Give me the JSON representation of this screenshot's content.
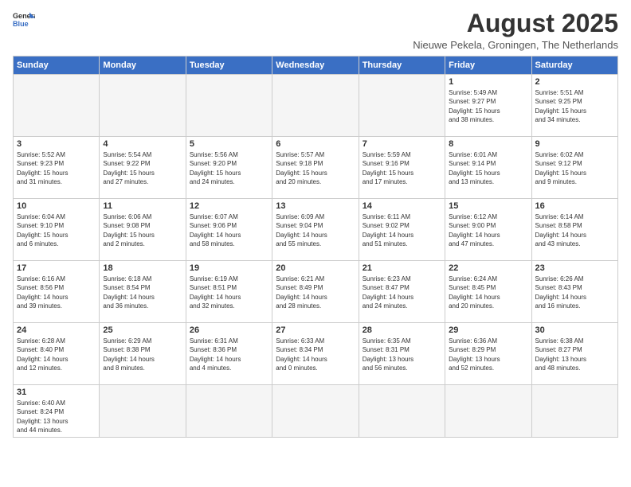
{
  "logo": {
    "line1": "General",
    "line2": "Blue"
  },
  "title": "August 2025",
  "subtitle": "Nieuwe Pekela, Groningen, The Netherlands",
  "weekdays": [
    "Sunday",
    "Monday",
    "Tuesday",
    "Wednesday",
    "Thursday",
    "Friday",
    "Saturday"
  ],
  "weeks": [
    [
      {
        "day": "",
        "info": ""
      },
      {
        "day": "",
        "info": ""
      },
      {
        "day": "",
        "info": ""
      },
      {
        "day": "",
        "info": ""
      },
      {
        "day": "",
        "info": ""
      },
      {
        "day": "1",
        "info": "Sunrise: 5:49 AM\nSunset: 9:27 PM\nDaylight: 15 hours\nand 38 minutes."
      },
      {
        "day": "2",
        "info": "Sunrise: 5:51 AM\nSunset: 9:25 PM\nDaylight: 15 hours\nand 34 minutes."
      }
    ],
    [
      {
        "day": "3",
        "info": "Sunrise: 5:52 AM\nSunset: 9:23 PM\nDaylight: 15 hours\nand 31 minutes."
      },
      {
        "day": "4",
        "info": "Sunrise: 5:54 AM\nSunset: 9:22 PM\nDaylight: 15 hours\nand 27 minutes."
      },
      {
        "day": "5",
        "info": "Sunrise: 5:56 AM\nSunset: 9:20 PM\nDaylight: 15 hours\nand 24 minutes."
      },
      {
        "day": "6",
        "info": "Sunrise: 5:57 AM\nSunset: 9:18 PM\nDaylight: 15 hours\nand 20 minutes."
      },
      {
        "day": "7",
        "info": "Sunrise: 5:59 AM\nSunset: 9:16 PM\nDaylight: 15 hours\nand 17 minutes."
      },
      {
        "day": "8",
        "info": "Sunrise: 6:01 AM\nSunset: 9:14 PM\nDaylight: 15 hours\nand 13 minutes."
      },
      {
        "day": "9",
        "info": "Sunrise: 6:02 AM\nSunset: 9:12 PM\nDaylight: 15 hours\nand 9 minutes."
      }
    ],
    [
      {
        "day": "10",
        "info": "Sunrise: 6:04 AM\nSunset: 9:10 PM\nDaylight: 15 hours\nand 6 minutes."
      },
      {
        "day": "11",
        "info": "Sunrise: 6:06 AM\nSunset: 9:08 PM\nDaylight: 15 hours\nand 2 minutes."
      },
      {
        "day": "12",
        "info": "Sunrise: 6:07 AM\nSunset: 9:06 PM\nDaylight: 14 hours\nand 58 minutes."
      },
      {
        "day": "13",
        "info": "Sunrise: 6:09 AM\nSunset: 9:04 PM\nDaylight: 14 hours\nand 55 minutes."
      },
      {
        "day": "14",
        "info": "Sunrise: 6:11 AM\nSunset: 9:02 PM\nDaylight: 14 hours\nand 51 minutes."
      },
      {
        "day": "15",
        "info": "Sunrise: 6:12 AM\nSunset: 9:00 PM\nDaylight: 14 hours\nand 47 minutes."
      },
      {
        "day": "16",
        "info": "Sunrise: 6:14 AM\nSunset: 8:58 PM\nDaylight: 14 hours\nand 43 minutes."
      }
    ],
    [
      {
        "day": "17",
        "info": "Sunrise: 6:16 AM\nSunset: 8:56 PM\nDaylight: 14 hours\nand 39 minutes."
      },
      {
        "day": "18",
        "info": "Sunrise: 6:18 AM\nSunset: 8:54 PM\nDaylight: 14 hours\nand 36 minutes."
      },
      {
        "day": "19",
        "info": "Sunrise: 6:19 AM\nSunset: 8:51 PM\nDaylight: 14 hours\nand 32 minutes."
      },
      {
        "day": "20",
        "info": "Sunrise: 6:21 AM\nSunset: 8:49 PM\nDaylight: 14 hours\nand 28 minutes."
      },
      {
        "day": "21",
        "info": "Sunrise: 6:23 AM\nSunset: 8:47 PM\nDaylight: 14 hours\nand 24 minutes."
      },
      {
        "day": "22",
        "info": "Sunrise: 6:24 AM\nSunset: 8:45 PM\nDaylight: 14 hours\nand 20 minutes."
      },
      {
        "day": "23",
        "info": "Sunrise: 6:26 AM\nSunset: 8:43 PM\nDaylight: 14 hours\nand 16 minutes."
      }
    ],
    [
      {
        "day": "24",
        "info": "Sunrise: 6:28 AM\nSunset: 8:40 PM\nDaylight: 14 hours\nand 12 minutes."
      },
      {
        "day": "25",
        "info": "Sunrise: 6:29 AM\nSunset: 8:38 PM\nDaylight: 14 hours\nand 8 minutes."
      },
      {
        "day": "26",
        "info": "Sunrise: 6:31 AM\nSunset: 8:36 PM\nDaylight: 14 hours\nand 4 minutes."
      },
      {
        "day": "27",
        "info": "Sunrise: 6:33 AM\nSunset: 8:34 PM\nDaylight: 14 hours\nand 0 minutes."
      },
      {
        "day": "28",
        "info": "Sunrise: 6:35 AM\nSunset: 8:31 PM\nDaylight: 13 hours\nand 56 minutes."
      },
      {
        "day": "29",
        "info": "Sunrise: 6:36 AM\nSunset: 8:29 PM\nDaylight: 13 hours\nand 52 minutes."
      },
      {
        "day": "30",
        "info": "Sunrise: 6:38 AM\nSunset: 8:27 PM\nDaylight: 13 hours\nand 48 minutes."
      }
    ],
    [
      {
        "day": "31",
        "info": "Sunrise: 6:40 AM\nSunset: 8:24 PM\nDaylight: 13 hours\nand 44 minutes."
      },
      {
        "day": "",
        "info": ""
      },
      {
        "day": "",
        "info": ""
      },
      {
        "day": "",
        "info": ""
      },
      {
        "day": "",
        "info": ""
      },
      {
        "day": "",
        "info": ""
      },
      {
        "day": "",
        "info": ""
      }
    ]
  ]
}
